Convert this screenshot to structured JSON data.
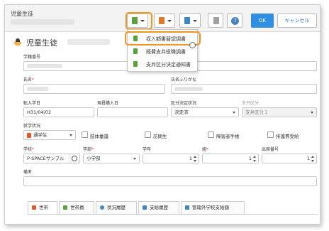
{
  "window": {
    "title": "児童生徒"
  },
  "toolbar": {
    "ok_label": "OK",
    "cancel_label": "キャンセル",
    "help_glyph": "?"
  },
  "dropdown": {
    "items": [
      {
        "label": "収入額書替認調書",
        "icon": "document-green-icon"
      },
      {
        "label": "経費支弁役職調書",
        "icon": "document-green-icon"
      },
      {
        "label": "支弁区分決定通知書",
        "icon": "document-green-icon"
      }
    ]
  },
  "page": {
    "title": "児童生徒"
  },
  "form": {
    "student_number_label": "学籍番号",
    "name_label": "氏名",
    "name_kana_label": "氏名ふりがな",
    "transfer_date_label": "転入学日",
    "transfer_date_value": "H31/04/02",
    "purchase_date_label": "現員購入日",
    "category_status_label": "区分決定状況",
    "category_status_value": "決定済",
    "payment_category_label": "支弁区分",
    "payment_category_value": "支弁区分１",
    "enrollment_label": "就学状況",
    "enrollment_value": "通学生",
    "chk_bessatsu": "肢体垂護",
    "chk_visit": "訪問生",
    "chk_disability": "障害者手帳",
    "chk_exempt": "排護費受給",
    "school_label": "学校",
    "school_value": "P-SPACEサンプル",
    "division_label": "学部",
    "division_value": "小学部",
    "grade_label": "学年",
    "grade_value": "1",
    "class_label": "組",
    "class_value": "1",
    "roll_label": "出席番号",
    "roll_value": "1",
    "notes_label": "備考"
  },
  "tabs": [
    {
      "label": "世帯",
      "icon": "home-icon",
      "color": "#e05a2a"
    },
    {
      "label": "世帯員",
      "icon": "members-icon",
      "color": "#5aa33c"
    },
    {
      "label": "状況履歴",
      "icon": "history-icon",
      "color": "#3f86c5"
    },
    {
      "label": "支給履歴",
      "icon": "payment-icon",
      "color": "#3f86c5"
    },
    {
      "label": "管理外学校支給額",
      "icon": "external-school-icon",
      "color": "#3f86c5"
    }
  ],
  "colors": {
    "accent": "#f0961e",
    "primary_button": "#2f8fe0"
  }
}
